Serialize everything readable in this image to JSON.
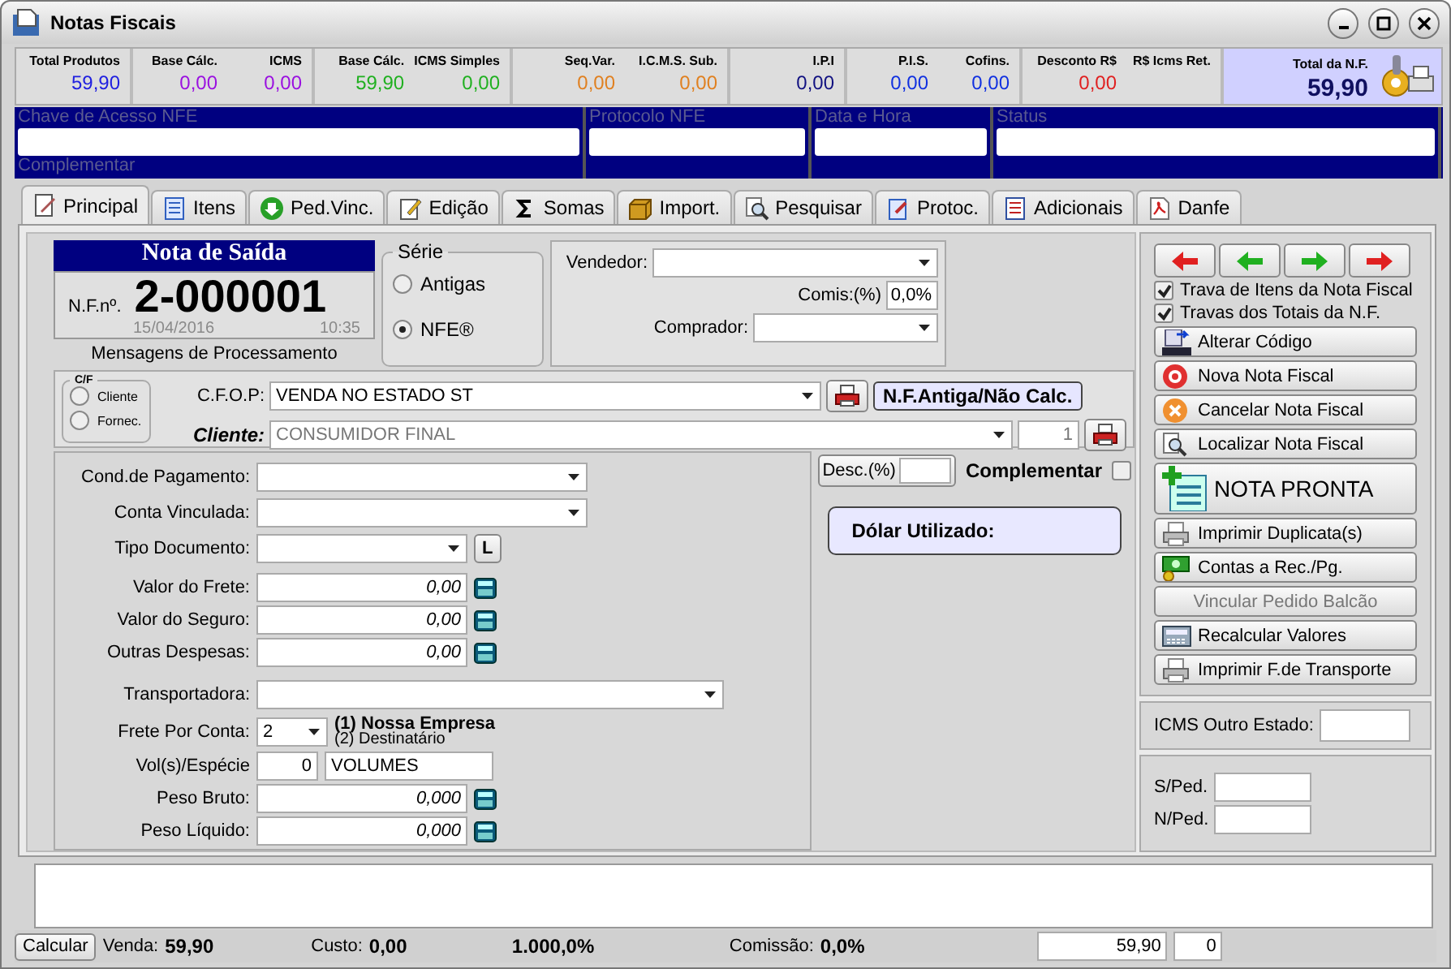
{
  "window": {
    "title": "Notas Fiscais"
  },
  "totals": [
    {
      "items": [
        {
          "label": "Total Produtos",
          "value": "59,90",
          "color": "#2020e0"
        }
      ]
    },
    {
      "items": [
        {
          "label": "Base Cálc.",
          "value": "0,00",
          "color": "#9a10e0"
        },
        {
          "label": "ICMS",
          "value": "0,00",
          "color": "#9a10e0"
        }
      ]
    },
    {
      "items": [
        {
          "label": "Base Cálc.",
          "value": "59,90",
          "color": "#20b020"
        },
        {
          "label": "ICMS Simples",
          "value": "0,00",
          "color": "#20b020"
        }
      ]
    },
    {
      "items": [
        {
          "label": "Seq.Var.",
          "value": "0,00",
          "color": "#e08020"
        },
        {
          "label": "I.C.M.S. Sub.",
          "value": "0,00",
          "color": "#e08020"
        }
      ]
    },
    {
      "items": [
        {
          "label": "I.P.I",
          "value": "0,00",
          "color": "#101080"
        }
      ]
    },
    {
      "items": [
        {
          "label": "P.I.S.",
          "value": "0,00",
          "color": "#1030e0"
        },
        {
          "label": "Cofins.",
          "value": "0,00",
          "color": "#1030e0"
        }
      ]
    },
    {
      "items": [
        {
          "label": "Desconto R$",
          "value": "0,00",
          "color": "#e02020"
        },
        {
          "label": "R$ Icms Ret."
        }
      ]
    }
  ],
  "total_nf": {
    "label": "Total da N.F.",
    "value": "59,90"
  },
  "nfe": {
    "fields": [
      {
        "label": "Chave de Acesso NFE"
      },
      {
        "label": "Protocolo NFE"
      },
      {
        "label": "Data e Hora"
      },
      {
        "label": "Status"
      }
    ],
    "note": "Complementar"
  },
  "tabs": [
    {
      "label": "Principal",
      "selected": true
    },
    {
      "label": "Itens",
      "selected": false
    },
    {
      "label": "Ped.Vinc.",
      "selected": false
    },
    {
      "label": "Edição",
      "selected": false
    },
    {
      "label": "Somas",
      "selected": false
    },
    {
      "label": "Import.",
      "selected": false
    },
    {
      "label": "Pesquisar",
      "selected": false
    },
    {
      "label": "Protoc.",
      "selected": false
    },
    {
      "label": "Adicionais",
      "selected": false
    },
    {
      "label": "Danfe",
      "selected": false
    }
  ],
  "nota": {
    "title": "Nota de Saída",
    "number_label": "N.F.nº.",
    "number": "2-000001",
    "date": "15/04/2016",
    "time": "10:35",
    "messages": "Mensagens de Processamento"
  },
  "serie": {
    "title": "Série",
    "options": [
      {
        "label": "Antigas",
        "selected": false
      },
      {
        "label": "NFE®",
        "selected": true
      }
    ]
  },
  "vendedor": {
    "label": "Vendedor:",
    "comis_label": "Comis:(%)",
    "comis": "0,0%",
    "comprador_label": "Comprador:"
  },
  "cf": {
    "title": "C/F",
    "options": [
      {
        "label": "Cliente",
        "selected": false
      },
      {
        "label": "Fornec.",
        "selected": false
      }
    ]
  },
  "cfop": {
    "label": "C.F.O.P:",
    "value": "VENDA NO ESTADO ST",
    "status": "N.F.Antiga/Não Calc."
  },
  "cliente": {
    "label": "Cliente:",
    "value": "CONSUMIDOR FINAL",
    "code": "1",
    "disabled": true
  },
  "form": [
    {
      "kind": "select",
      "label": "Cond.de Pagamento:"
    },
    {
      "kind": "select",
      "label": "Conta Vinculada:"
    },
    {
      "kind": "select_button",
      "label": "Tipo Documento:",
      "button": "L"
    },
    {
      "kind": "money",
      "label": "Valor do Frete:",
      "value": "0,00"
    },
    {
      "kind": "money",
      "label": "Valor do Seguro:",
      "value": "0,00"
    },
    {
      "kind": "money",
      "label": "Outras Despesas:",
      "value": "0,00"
    },
    {
      "kind": "wide_select",
      "label": "Transportadora:"
    },
    {
      "kind": "frete",
      "label": "Frete Por Conta:",
      "value": "2",
      "options": [
        {
          "label": "(1) Nossa Empresa",
          "bold": true
        },
        {
          "label": "(2) Destinatário",
          "bold": false
        }
      ]
    },
    {
      "kind": "volumes",
      "label": "Vol(s)/Espécie",
      "value": "0",
      "species": "VOLUMES"
    },
    {
      "kind": "money",
      "label": "Peso Bruto:",
      "value": "0,000"
    },
    {
      "kind": "money",
      "label": "Peso Líquido:",
      "value": "0,000"
    }
  ],
  "desc": {
    "label": "Desc.(%)"
  },
  "complementar": {
    "label": "Complementar",
    "checked": false
  },
  "dolar": {
    "label": "Dólar Utilizado:"
  },
  "locks": [
    {
      "label": "Trava de Itens da Nota Fiscal",
      "checked": true
    },
    {
      "label": "Travas dos Totais da N.F.",
      "checked": true
    }
  ],
  "actions": [
    {
      "label": "Alterar Código",
      "kind": "normal",
      "disabled": false
    },
    {
      "label": "Nova Nota Fiscal",
      "kind": "normal",
      "disabled": false
    },
    {
      "label": "Cancelar Nota Fiscal",
      "kind": "normal",
      "disabled": false
    },
    {
      "label": "Localizar Nota Fiscal",
      "kind": "normal",
      "disabled": false
    },
    {
      "label": "NOTA PRONTA",
      "kind": "large",
      "disabled": false
    },
    {
      "label": "Imprimir Duplicata(s)",
      "kind": "normal",
      "disabled": false
    },
    {
      "label": "Contas a Rec./Pg.",
      "kind": "normal",
      "disabled": false
    },
    {
      "label": "Vincular Pedido Balcão",
      "kind": "normal",
      "disabled": true
    },
    {
      "label": "Recalcular Valores",
      "kind": "normal",
      "disabled": false
    },
    {
      "label": "Imprimir F.de Transporte",
      "kind": "normal",
      "disabled": false
    }
  ],
  "icms_outro": {
    "label": "ICMS Outro Estado:"
  },
  "ped": [
    {
      "label": "S/Ped."
    },
    {
      "label": "N/Ped."
    }
  ],
  "status": {
    "button": "Calcular",
    "venda_label": "Venda:",
    "venda": "59,90",
    "custo_label": "Custo:",
    "custo": "0,00",
    "percent": "1.000,0%",
    "comissao_label": "Comissão:",
    "comissao": "0,0%",
    "total": "59,90",
    "count": "0"
  }
}
